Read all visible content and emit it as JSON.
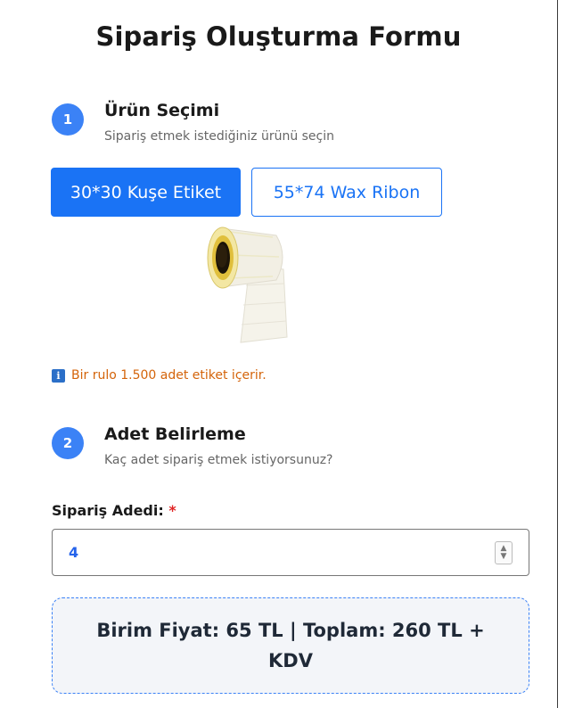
{
  "form": {
    "title": "Sipariş Oluşturma Formu"
  },
  "step1": {
    "number": "1",
    "title": "Ürün Seçimi",
    "subtitle": "Sipariş etmek istediğiniz ürünü seçin",
    "products": [
      {
        "label": "30*30 Kuşe Etiket",
        "selected": true
      },
      {
        "label": "55*74 Wax Ribon",
        "selected": false
      }
    ],
    "info_icon": "info-icon",
    "info_text": "Bir rulo 1.500 adet etiket içerir."
  },
  "step2": {
    "number": "2",
    "title": "Adet Belirleme",
    "subtitle": "Kaç adet sipariş etmek istiyorsunuz?",
    "quantity_label": "Sipariş Adedi:",
    "required_mark": "*",
    "quantity_value": "4"
  },
  "summary": {
    "text": "Birim Fiyat: 65 TL | Toplam: 260 TL + KDV"
  },
  "colors": {
    "accent": "#1a73f5",
    "step_circle": "#3b82f6",
    "info_text": "#d4640a",
    "required": "#e02424"
  }
}
